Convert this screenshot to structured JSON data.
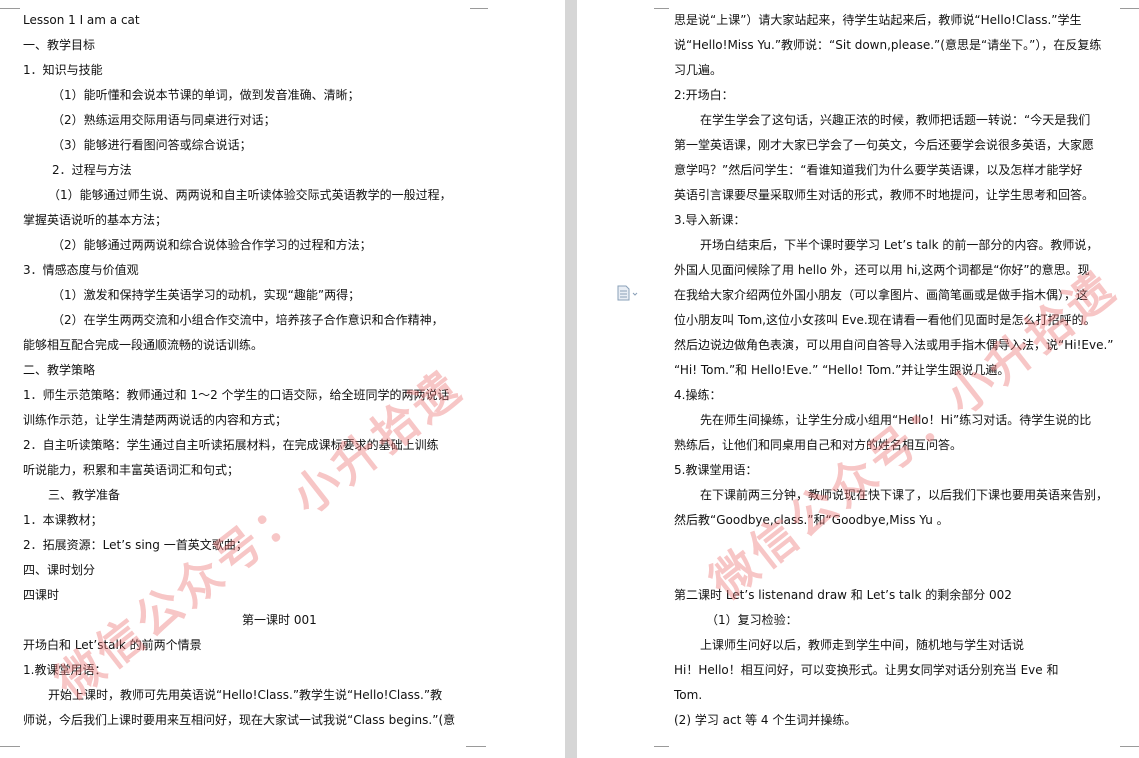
{
  "left_page": {
    "lines": [
      {
        "t": "Lesson 1    I am a cat"
      },
      {
        "t": "一、教学目标"
      },
      {
        "t": "1．知识与技能"
      },
      {
        "t": "（1）能听懂和会说本节课的单词，做到发音准确、清晰；"
      },
      {
        "t": "（2）熟练运用交际用语与同桌进行对话；"
      },
      {
        "t": "（3）能够进行看图问答或综合说话；"
      },
      {
        "t": "2．过程与方法"
      },
      {
        "t": "（1）能够通过师生说、两两说和自主听读体验交际式英语教学的一般过程，"
      },
      {
        "t": "掌握英语说听的基本方法；"
      },
      {
        "t": "（2）能够通过两两说和综合说体验合作学习的过程和方法；"
      },
      {
        "t": "3．情感态度与价值观"
      },
      {
        "t": "（1）激发和保持学生英语学习的动机，实现“趣能”两得；"
      },
      {
        "t": "（2）在学生两两交流和小组合作交流中，培养孩子合作意识和合作精神，"
      },
      {
        "t": "能够相互配合完成一段通顺流畅的说话训练。"
      },
      {
        "t": "二、教学策略"
      },
      {
        "t": "1．师生示范策略：教师通过和 1～2 个学生的口语交际，给全班同学的两两说话"
      },
      {
        "t": "训练作示范，让学生清楚两两说话的内容和方式；"
      },
      {
        "t": "2．自主听读策略：学生通过自主听读拓展材料，在完成课标要求的基础上训练"
      },
      {
        "t": "听说能力，积累和丰富英语词汇和句式；"
      },
      {
        "t": "三、教学准备"
      },
      {
        "t": "1．本课教材；"
      },
      {
        "t": "2．拓展资源：Let’s sing 一首英文歌曲；"
      },
      {
        "t": "四、课时划分"
      },
      {
        "t": "四课时"
      },
      {
        "t": "第一课时        001"
      },
      {
        "t": "开场白和 Let’stalk 的前两个情景"
      },
      {
        "t": "1.教课堂用语："
      },
      {
        "t": "开始上课时，教师可先用英语说“Hello!Class.”教学生说“Hello!Class.”教"
      },
      {
        "t": "师说，今后我们上课时要用来互相问好，现在大家试一试我说“Class begins.”(意"
      }
    ],
    "watermark": "微信公众号：小升拾遗"
  },
  "right_page": {
    "lines": [
      {
        "t": "思是说“上课”）请大家站起来，待学生站起来后，教师说“Hello!Class.”学生"
      },
      {
        "t": "说“Hello!Miss Yu.”教师说：“Sit down,please.”(意思是“请坐下。”），在反复练"
      },
      {
        "t": "习几遍。"
      },
      {
        "t": "2:开场白："
      },
      {
        "t": "在学生学会了这句话，兴趣正浓的时候，教师把话题一转说：“今天是我们"
      },
      {
        "t": "第一堂英语课，刚才大家已学会了一句英文，今后还要学会说很多英语，大家愿"
      },
      {
        "t": "意学吗？”然后问学生：“看谁知道我们为什么要学英语课，以及怎样才能学好"
      },
      {
        "t": "英语引言课要尽量采取师生对话的形式，教师不时地提问，让学生思考和回答。"
      },
      {
        "t": "3.导入新课："
      },
      {
        "t": "开场白结束后，下半个课时要学习 Let’s talk 的前一部分的内容。教师说，"
      },
      {
        "t": "外国人见面问候除了用 hello 外，还可以用 hi,这两个词都是“你好”的意思。现"
      },
      {
        "t": "在我给大家介绍两位外国小朋友（可以拿图片、画简笔画或是做手指木偶），这"
      },
      {
        "t": "位小朋友叫 Tom,这位小女孩叫 Eve.现在请看一看他们见面时是怎么打招呼的。"
      },
      {
        "t": "然后边说边做角色表演，可以用自问自答导入法或用手指木偶导入法，说“Hi!Eve.”"
      },
      {
        "t": "“Hi! Tom.”和 Hello!Eve.”  “Hello! Tom.”并让学生跟说几遍。"
      },
      {
        "t": "4.操练："
      },
      {
        "t": "先在师生间操练，让学生分成小组用“Hello！Hi”练习对话。待学生说的比"
      },
      {
        "t": "熟练后，让他们和同桌用自己和对方的姓名相互问答。"
      },
      {
        "t": "5.教课堂用语："
      },
      {
        "t": "在下课前两三分钟，教师说现在快下课了，以后我们下课也要用英语来告别，"
      },
      {
        "t": "然后教“Goodbye,class.”和“Goodbye,Miss Yu  。"
      },
      {
        "t": "第二课时  Let’s listenand draw 和 Let’s talk 的剩余部分          002"
      },
      {
        "t": "（1）复习检验："
      },
      {
        "t": "上课师生问好以后，教师走到学生中间，随机地与学生对话说"
      },
      {
        "t": "Hi！Hello！相互问好，可以变换形式。让男女同学对话分别充当 Eve 和"
      },
      {
        "t": "Tom."
      },
      {
        "t": "(2) 学习 act 等 4 个生词并操练。"
      }
    ],
    "watermark": "微信公众号：小升拾遗"
  },
  "colors": {
    "watermark": "#ec7878",
    "gutter": "#d6d6d6",
    "crop_mark": "#9a9a9a"
  },
  "icons": [
    "document-icon"
  ]
}
